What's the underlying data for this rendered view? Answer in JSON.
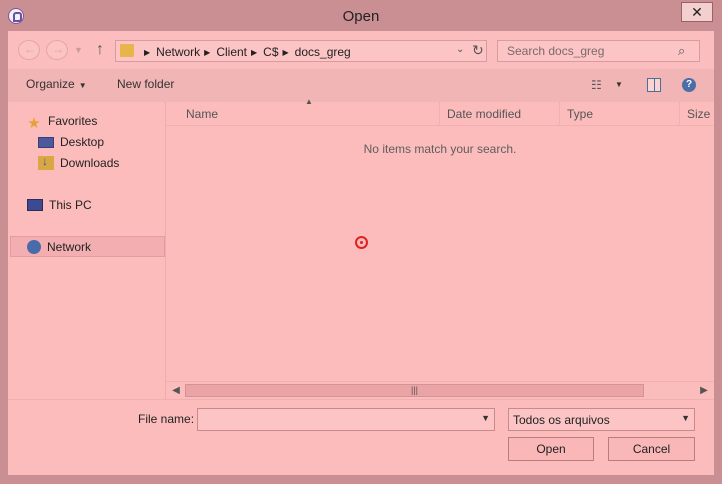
{
  "window": {
    "title": "Open"
  },
  "icons": {
    "app": "app-icon",
    "close": "close-icon",
    "back": "back-arrow-icon",
    "forward": "forward-arrow-icon",
    "up": "up-arrow-icon",
    "folder": "folder-icon",
    "refresh": "refresh-icon",
    "search": "search-icon",
    "view": "view-options-icon",
    "preview_pane": "preview-pane-icon",
    "help": "help-icon",
    "cursor": "crosshair-target-icon"
  },
  "address": {
    "crumbs": [
      "Network",
      "Client",
      "C$",
      "docs_greg"
    ]
  },
  "search": {
    "placeholder": "Search docs_greg"
  },
  "toolbar": {
    "organize": "Organize",
    "new_folder": "New folder"
  },
  "nav": {
    "favorites": "Favorites",
    "desktop": "Desktop",
    "downloads": "Downloads",
    "this_pc": "This PC",
    "network": "Network",
    "selected": "Network"
  },
  "columns": {
    "name": "Name",
    "date": "Date modified",
    "type": "Type",
    "size": "Size"
  },
  "list": {
    "empty_message": "No items match your search."
  },
  "footer": {
    "file_name_label": "File name:",
    "file_name_value": "",
    "file_type": "Todos os arquivos",
    "open": "Open",
    "cancel": "Cancel"
  },
  "colors": {
    "background": "#fdbcbc",
    "frame": "#c98f93",
    "cursor": "#dd2222"
  }
}
